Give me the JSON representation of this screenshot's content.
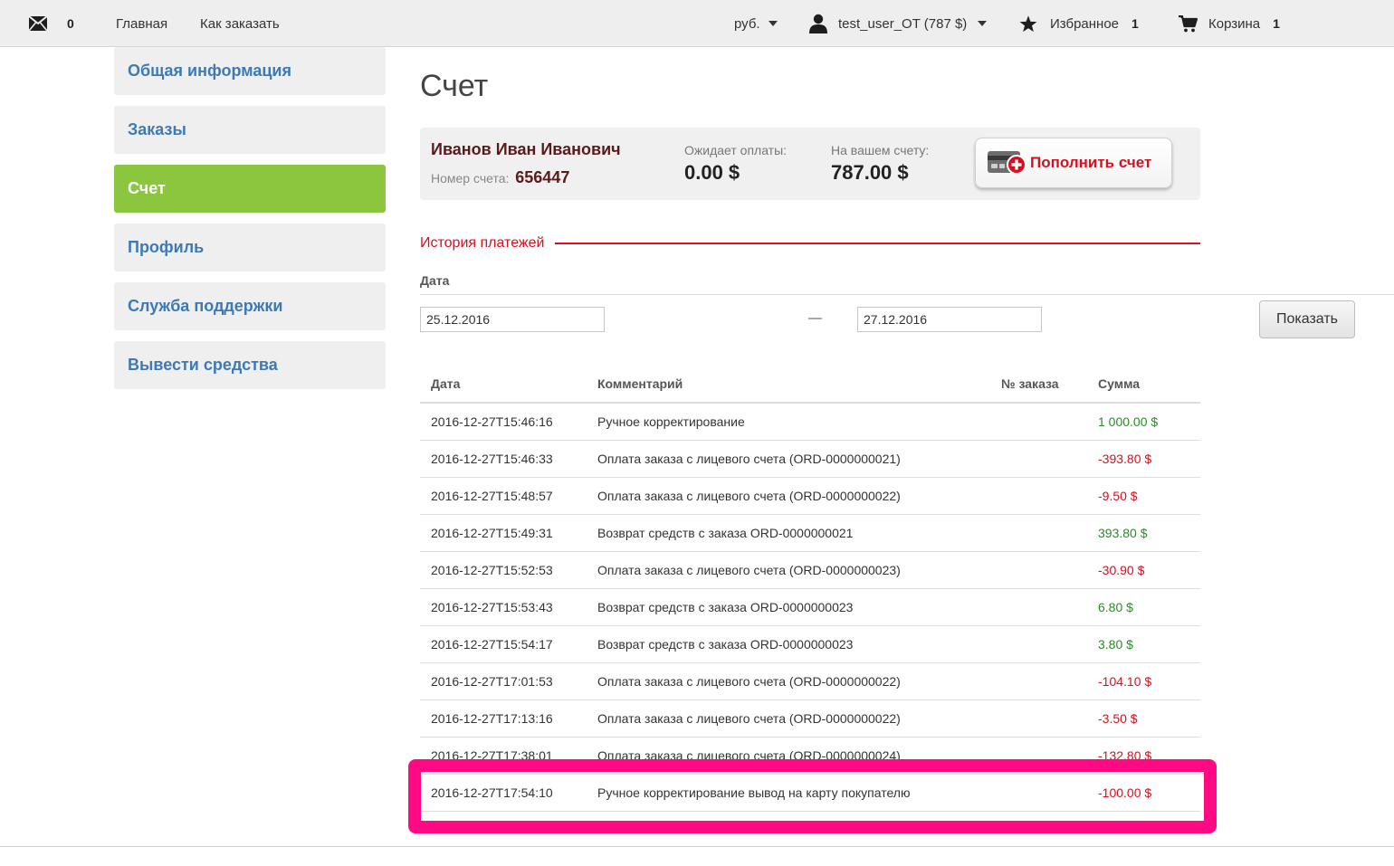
{
  "nav": {
    "messages_count": "0",
    "home": "Главная",
    "how_to_order": "Как заказать",
    "currency": "руб.",
    "user": "test_user_OT (787 $)",
    "favorites_label": "Избранное",
    "favorites_count": "1",
    "cart_label": "Корзина",
    "cart_count": "1"
  },
  "sidebar": {
    "items": [
      {
        "label": "Общая информация"
      },
      {
        "label": "Заказы"
      },
      {
        "label": "Счет"
      },
      {
        "label": "Профиль"
      },
      {
        "label": "Служба поддержки"
      },
      {
        "label": "Вывести средства"
      }
    ],
    "active": "Счет"
  },
  "page": {
    "title": "Счет"
  },
  "account": {
    "name": "Иванов Иван Иванович",
    "number_label": "Номер счета:",
    "number": "656447",
    "pending_label": "Ожидает оплаты:",
    "pending_value": "0.00 $",
    "balance_label": "На вашем счету:",
    "balance_value": "787.00 $",
    "topup_label": "Пополнить счет"
  },
  "history": {
    "title": "История платежей",
    "date_label": "Дата",
    "date_from": "25.12.2016",
    "date_sep": "—",
    "date_to": "27.12.2016",
    "show_button": "Показать",
    "columns": {
      "date": "Дата",
      "comment": "Комментарий",
      "order": "№ заказа",
      "sum": "Сумма"
    },
    "rows": [
      {
        "date": "2016-12-27T15:46:16",
        "comment": "Ручное корректирование",
        "order": "",
        "sum": "1 000.00 $"
      },
      {
        "date": "2016-12-27T15:46:33",
        "comment": "Оплата заказа с лицевого счета (ORD-0000000021)",
        "order": "",
        "sum": "-393.80 $"
      },
      {
        "date": "2016-12-27T15:48:57",
        "comment": "Оплата заказа с лицевого счета (ORD-0000000022)",
        "order": "",
        "sum": "-9.50 $"
      },
      {
        "date": "2016-12-27T15:49:31",
        "comment": "Возврат средств с заказа ORD-0000000021",
        "order": "",
        "sum": "393.80 $"
      },
      {
        "date": "2016-12-27T15:52:53",
        "comment": "Оплата заказа с лицевого счета (ORD-0000000023)",
        "order": "",
        "sum": "-30.90 $"
      },
      {
        "date": "2016-12-27T15:53:43",
        "comment": "Возврат средств с заказа ORD-0000000023",
        "order": "",
        "sum": "6.80 $"
      },
      {
        "date": "2016-12-27T15:54:17",
        "comment": "Возврат средств с заказа ORD-0000000023",
        "order": "",
        "sum": "3.80 $"
      },
      {
        "date": "2016-12-27T17:01:53",
        "comment": "Оплата заказа с лицевого счета (ORD-0000000022)",
        "order": "",
        "sum": "-104.10 $"
      },
      {
        "date": "2016-12-27T17:13:16",
        "comment": "Оплата заказа с лицевого счета (ORD-0000000022)",
        "order": "",
        "sum": "-3.50 $"
      },
      {
        "date": "2016-12-27T17:38:01",
        "comment": "Оплата заказа с лицевого счета (ORD-0000000024)",
        "order": "",
        "sum": "-132.80 $"
      },
      {
        "date": "2016-12-27T17:54:10",
        "comment": "Ручное корректирование вывод на карту покупателю",
        "order": "",
        "sum": "-100.00 $"
      }
    ]
  },
  "colors": {
    "active_sidebar": "#8cc63f",
    "sidebar_link": "#3d7ab4",
    "accent_red": "#d6101e",
    "positive": "#2a8a2a",
    "highlight": "#ff0a84"
  },
  "icons": {
    "messages": "envelope-icon",
    "user": "user-icon",
    "favorites": "star-icon",
    "cart": "cart-icon",
    "topup": "credit-card-plus-icon"
  }
}
